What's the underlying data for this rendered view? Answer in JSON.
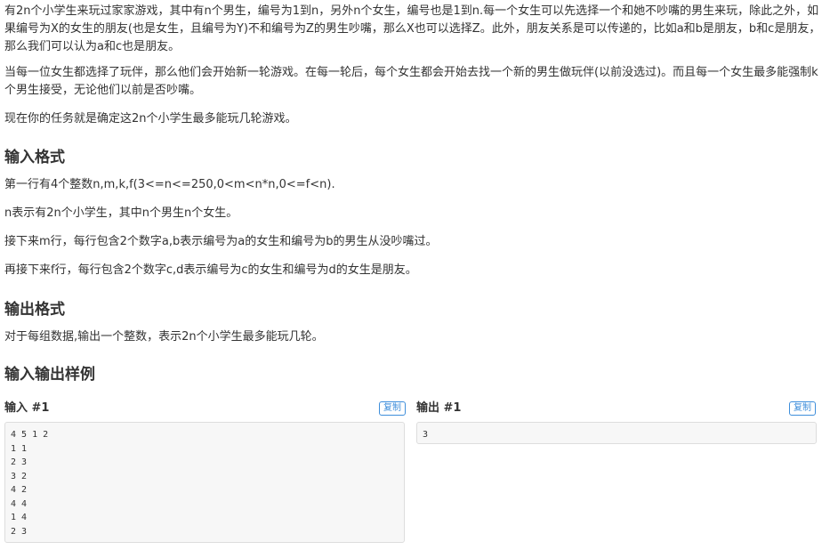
{
  "description": {
    "p1": "有2n个小学生来玩过家家游戏，其中有n个男生，编号为1到n，另外n个女生，编号也是1到n.每一个女生可以先选择一个和她不吵嘴的男生来玩，除此之外，如果编号为X的女生的朋友(也是女生，且编号为Y)不和编号为Z的男生吵嘴，那么X也可以选择Z。此外，朋友关系是可以传递的，比如a和b是朋友，b和c是朋友，那么我们可以认为a和c也是朋友。",
    "p2": "当每一位女生都选择了玩伴，那么他们会开始新一轮游戏。在每一轮后，每个女生都会开始去找一个新的男生做玩伴(以前没选过)。而且每一个女生最多能强制k个男生接受，无论他们以前是否吵嘴。",
    "p3": "现在你的任务就是确定这2n个小学生最多能玩几轮游戏。"
  },
  "input_format": {
    "heading": "输入格式",
    "lines": [
      "第一行有4个整数n,m,k,f(3<=n<=250,0<m<n*n,0<=f<n).",
      "n表示有2n个小学生，其中n个男生n个女生。",
      "接下来m行，每行包含2个数字a,b表示编号为a的女生和编号为b的男生从没吵嘴过。",
      "再接下来f行，每行包含2个数字c,d表示编号为c的女生和编号为d的女生是朋友。"
    ]
  },
  "output_format": {
    "heading": "输出格式",
    "lines": [
      "对于每组数据,输出一个整数，表示2n个小学生最多能玩几轮。"
    ]
  },
  "samples": {
    "heading": "输入输出样例",
    "input_label": "输入 #1",
    "output_label": "输出 #1",
    "copy_label": "复制",
    "input_lines": [
      "4 5 1 2",
      "1 1",
      "2 3",
      "3 2",
      "4 2",
      "4 4",
      "1 4",
      "2 3"
    ],
    "output_lines": [
      "3"
    ]
  }
}
